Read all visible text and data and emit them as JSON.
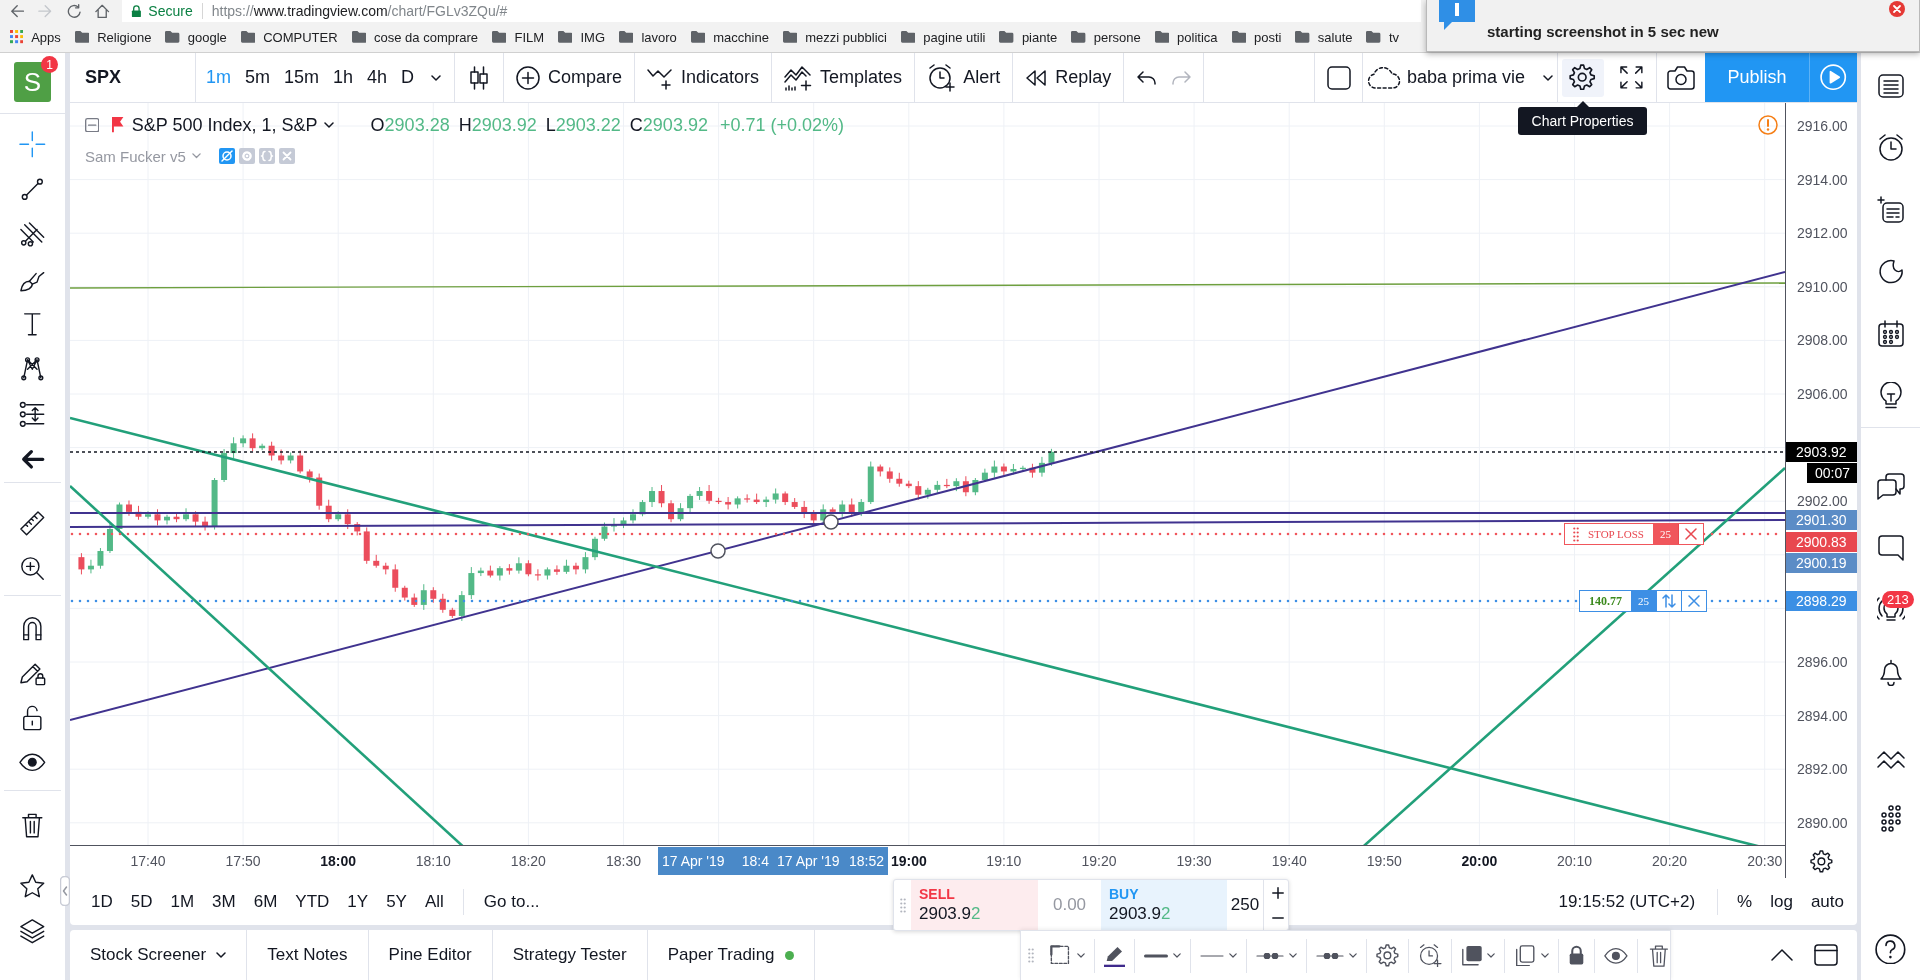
{
  "browser": {
    "secure_label": "Secure",
    "url": {
      "scheme": "https://",
      "host": "www.tradingview.com",
      "path": "/chart/FGLv3ZQu/#"
    },
    "bookmarks": [
      {
        "label": "Apps",
        "kind": "apps"
      },
      {
        "label": "Religione",
        "kind": "folder"
      },
      {
        "label": "google",
        "kind": "folder"
      },
      {
        "label": "COMPUTER",
        "kind": "folder"
      },
      {
        "label": "cose da comprare",
        "kind": "folder"
      },
      {
        "label": "FILM",
        "kind": "folder"
      },
      {
        "label": "IMG",
        "kind": "folder"
      },
      {
        "label": "lavoro",
        "kind": "folder"
      },
      {
        "label": "macchine",
        "kind": "folder"
      },
      {
        "label": "mezzi pubblici",
        "kind": "folder"
      },
      {
        "label": "pagine utili",
        "kind": "folder"
      },
      {
        "label": "piante",
        "kind": "folder"
      },
      {
        "label": "persone",
        "kind": "folder"
      },
      {
        "label": "politica",
        "kind": "folder"
      },
      {
        "label": "posti",
        "kind": "folder"
      },
      {
        "label": "salute",
        "kind": "folder"
      },
      {
        "label": "tv",
        "kind": "folder"
      }
    ]
  },
  "notification": {
    "text": "starting screenshot in 5 sec new"
  },
  "account": {
    "initial": "S",
    "badge": "1"
  },
  "toolbar": {
    "symbol": "SPX",
    "intervals": [
      {
        "label": "1m",
        "selected": true
      },
      {
        "label": "5m",
        "selected": false
      },
      {
        "label": "15m",
        "selected": false
      },
      {
        "label": "1h",
        "selected": false
      },
      {
        "label": "4h",
        "selected": false
      },
      {
        "label": "D",
        "selected": false
      }
    ],
    "actions": [
      {
        "label": "Compare",
        "kind": "compare"
      },
      {
        "label": "Indicators",
        "kind": "indicators"
      },
      {
        "label": "Templates",
        "kind": "templates"
      },
      {
        "label": "Alert",
        "kind": "alert"
      },
      {
        "label": "Replay",
        "kind": "replay"
      }
    ],
    "layout_name": "baba prima vie",
    "publish": "Publish",
    "tooltip": "Chart Properties"
  },
  "left_toolbar": {
    "tool_groups": [
      {
        "tools": [
          {
            "kind": "crosshair",
            "selected": true
          },
          {
            "kind": "trend_line",
            "selected": false
          },
          {
            "kind": "pitchfork",
            "selected": false
          },
          {
            "kind": "brush",
            "selected": false
          },
          {
            "kind": "text",
            "selected": false
          },
          {
            "kind": "pattern",
            "selected": false
          },
          {
            "kind": "prediction",
            "selected": false
          },
          {
            "kind": "remove",
            "selected": false
          }
        ]
      },
      {
        "tools": [
          {
            "kind": "measure",
            "selected": false
          },
          {
            "kind": "zoom",
            "selected": false
          }
        ]
      },
      {
        "tools": [
          {
            "kind": "magnet",
            "selected": false
          },
          {
            "kind": "stay_in_drawing",
            "selected": false
          },
          {
            "kind": "lock",
            "selected": false
          },
          {
            "kind": "visibility",
            "selected": false
          }
        ]
      },
      {
        "tools": [
          {
            "kind": "delete",
            "selected": false
          }
        ]
      },
      {
        "tools": [
          {
            "kind": "favorites",
            "selected": false
          },
          {
            "kind": "object_tree",
            "selected": false
          }
        ]
      }
    ]
  },
  "legend": {
    "title": "S&P 500 Index, 1, S&P",
    "ohlc": [
      {
        "key": "O",
        "value": "2903.28"
      },
      {
        "key": "H",
        "value": "2903.92"
      },
      {
        "key": "L",
        "value": "2903.22"
      },
      {
        "key": "C",
        "value": "2903.92"
      }
    ],
    "change": "+0.71 (+0.02%)",
    "indicator": "Sam Fucker v5"
  },
  "price_axis": {
    "labels": [
      "2916.00",
      "2914.00",
      "2912.00",
      "2910.00",
      "2908.00",
      "2906.00",
      "2902.00",
      "2896.00",
      "2894.00",
      "2892.00",
      "2890.00"
    ],
    "tags": [
      {
        "text": "2903.92",
        "kind": "price",
        "color": "#000000"
      },
      {
        "text": "00:07",
        "kind": "countdown",
        "color": "#000000"
      },
      {
        "text": "2901.30",
        "kind": "price",
        "color": "#5b8cc6"
      },
      {
        "text": "2900.83",
        "kind": "price",
        "color": "#e8474f"
      },
      {
        "text": "2900.19",
        "kind": "price",
        "color": "#5b8cc6"
      },
      {
        "text": "2898.29",
        "kind": "price",
        "color": "#3b8fe4"
      }
    ]
  },
  "time_axis": {
    "labels": [
      {
        "text": "17:40",
        "kind": "minute"
      },
      {
        "text": "17:50",
        "kind": "minute"
      },
      {
        "text": "18:00",
        "kind": "hour"
      },
      {
        "text": "18:10",
        "kind": "minute"
      },
      {
        "text": "18:20",
        "kind": "minute"
      },
      {
        "text": "18:30",
        "kind": "minute"
      },
      {
        "text": "19:00",
        "kind": "hour"
      },
      {
        "text": "19:10",
        "kind": "minute"
      },
      {
        "text": "19:20",
        "kind": "minute"
      },
      {
        "text": "19:30",
        "kind": "minute"
      },
      {
        "text": "19:40",
        "kind": "minute"
      },
      {
        "text": "19:50",
        "kind": "minute"
      },
      {
        "text": "20:00",
        "kind": "hour"
      },
      {
        "text": "20:10",
        "kind": "minute"
      },
      {
        "text": "20:20",
        "kind": "minute"
      },
      {
        "text": "20:30",
        "kind": "minute"
      }
    ],
    "cursor_labels": [
      {
        "date": "17 Apr '19",
        "time": "18:4"
      },
      {
        "date": "17 Apr '19",
        "time": "18:52"
      }
    ]
  },
  "orders": [
    {
      "kind": "stop",
      "label": "STOP LOSS",
      "quantity": "25"
    },
    {
      "kind": "limit",
      "label": "140.77",
      "quantity": "25"
    }
  ],
  "bottom_bar": {
    "ranges": [
      "1D",
      "5D",
      "1M",
      "3M",
      "6M",
      "YTD",
      "1Y",
      "5Y",
      "All"
    ],
    "goto": "Go to...",
    "clock": "19:15:52 (UTC+2)",
    "scale_options": [
      "%",
      "log",
      "auto"
    ]
  },
  "trade_panel": {
    "sell": {
      "label": "SELL",
      "price": "2903.9",
      "price_tail": "2"
    },
    "spread": "0.00",
    "buy": {
      "label": "BUY",
      "price": "2903.9",
      "price_tail": "2"
    },
    "quantity": "250"
  },
  "bottom_tabs": [
    {
      "label": "Stock Screener",
      "kind": "dropdown"
    },
    {
      "label": "Text Notes",
      "kind": "plain"
    },
    {
      "label": "Pine Editor",
      "kind": "plain"
    },
    {
      "label": "Strategy Tester",
      "kind": "plain"
    },
    {
      "label": "Paper Trading",
      "kind": "status"
    }
  ],
  "right_sidebar": {
    "badge": "213"
  }
}
